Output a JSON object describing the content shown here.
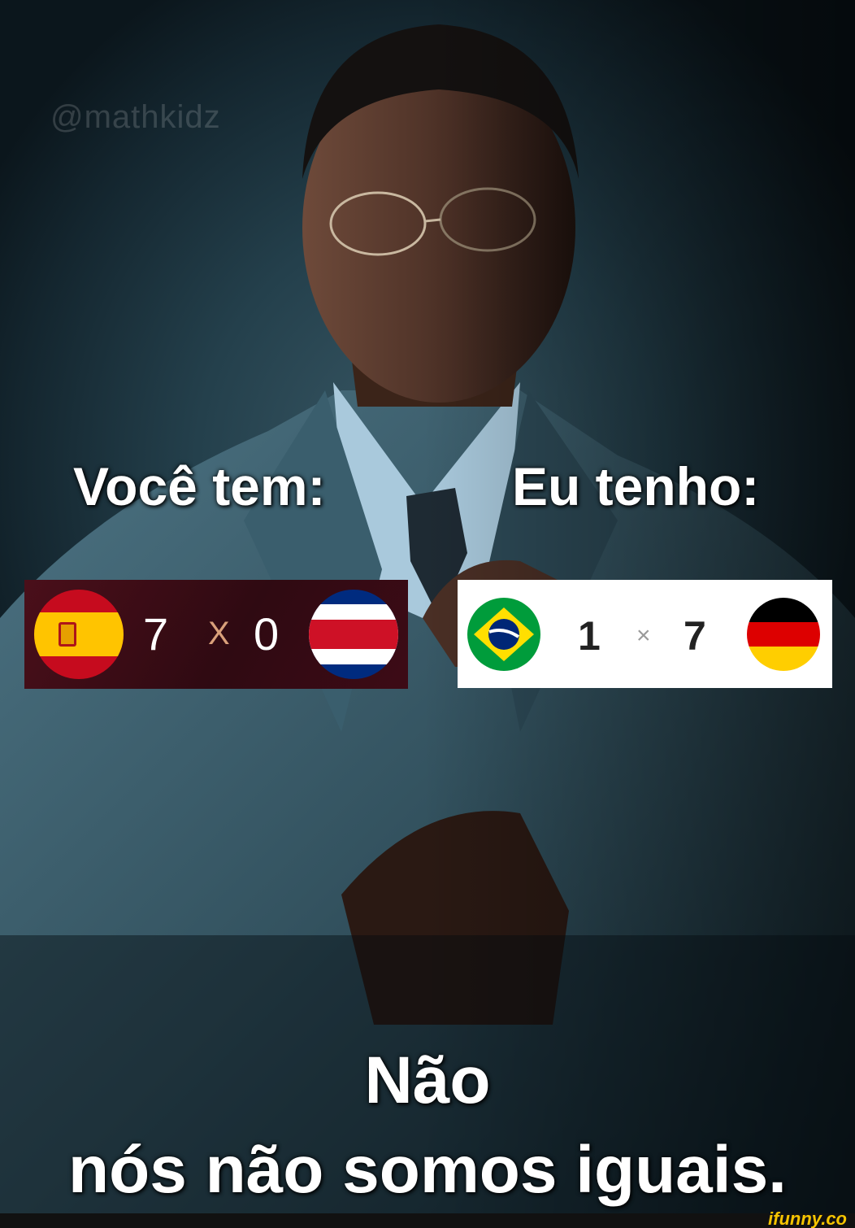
{
  "watermark": "@mathkidz",
  "captions": {
    "left": "Você tem:",
    "right": "Eu tenho:",
    "bottom_line1": "Não",
    "bottom_line2": "nós não somos iguais."
  },
  "left_match": {
    "home_score": "7",
    "separator": "X",
    "away_score": "0",
    "home_flag": "spain-flag-icon",
    "away_flag": "costa-rica-flag-icon"
  },
  "right_match": {
    "home_score": "1",
    "separator": "×",
    "away_score": "7",
    "home_flag": "brazil-flag-icon",
    "away_flag": "germany-flag-icon"
  },
  "brand": "ifunny.co",
  "colors": {
    "background": "#24404c",
    "suit": "#3f6474",
    "card_left_bg": "#3d0b16",
    "brand": "#f5c400"
  }
}
